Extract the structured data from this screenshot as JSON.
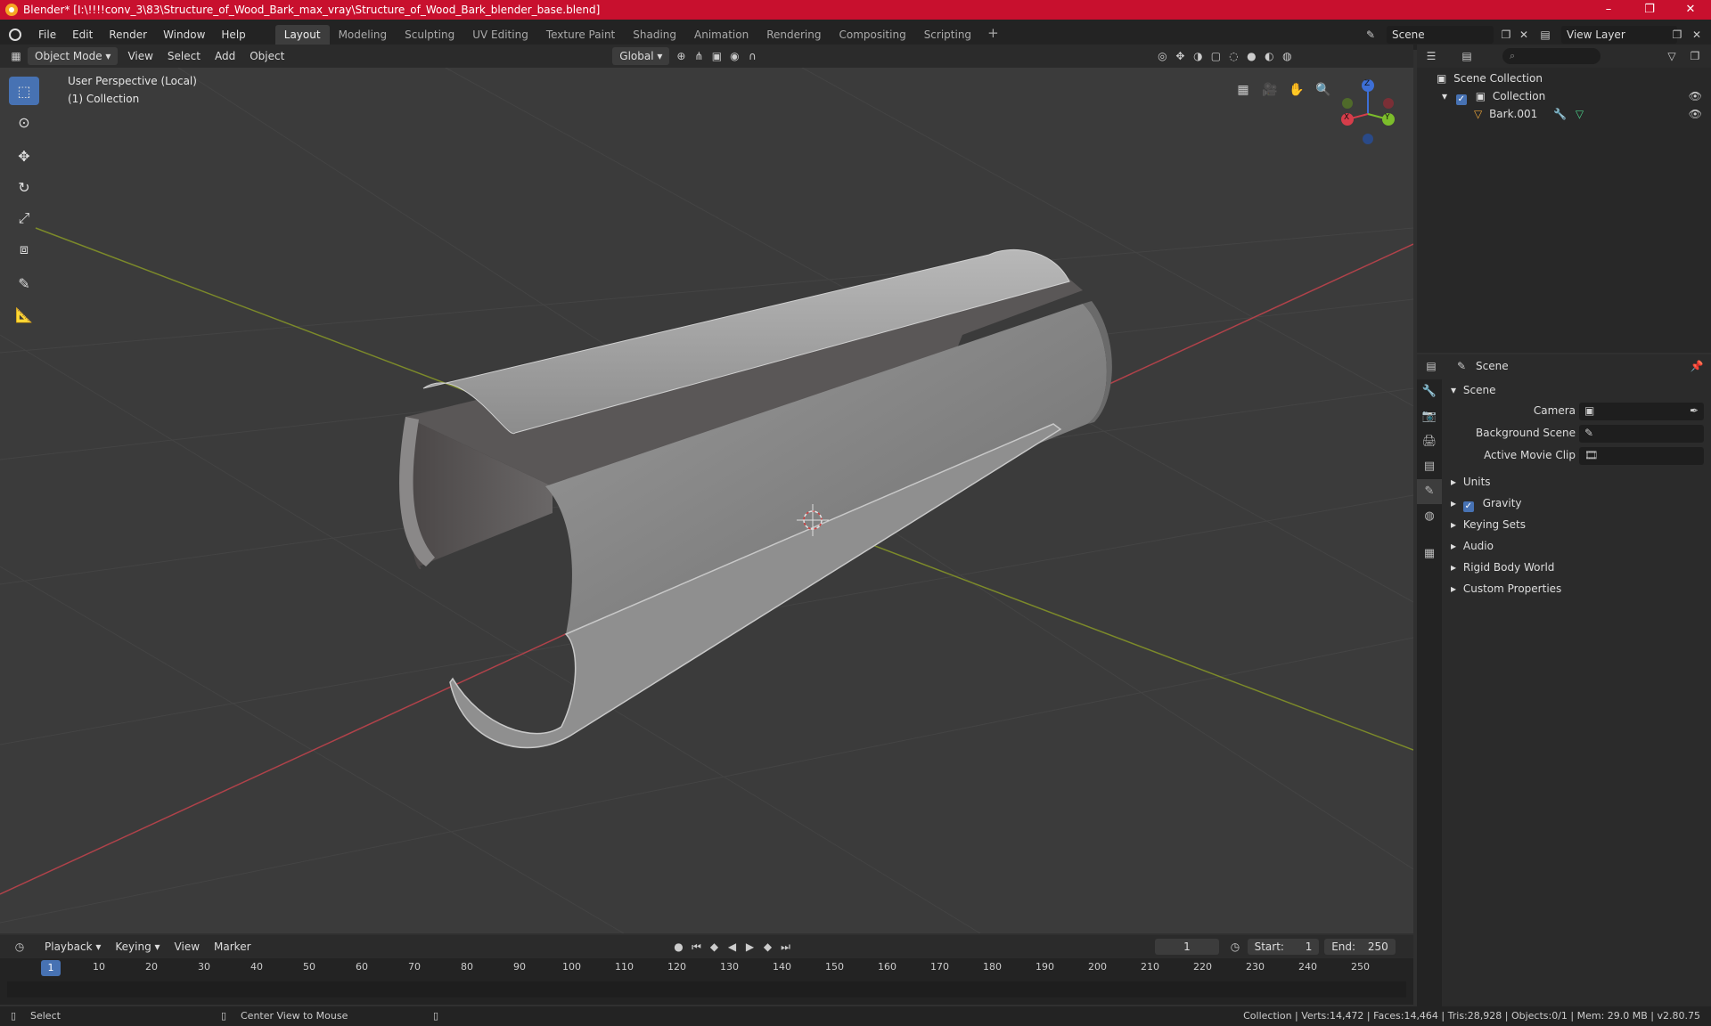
{
  "window": {
    "title": "Blender* [I:\\!!!!conv_3\\83\\Structure_of_Wood_Bark_max_vray\\Structure_of_Wood_Bark_blender_base.blend]",
    "minimize": "–",
    "maximize": "❐",
    "close": "✕"
  },
  "menu": [
    "File",
    "Edit",
    "Render",
    "Window",
    "Help"
  ],
  "workspaces": [
    "Layout",
    "Modeling",
    "Sculpting",
    "UV Editing",
    "Texture Paint",
    "Shading",
    "Animation",
    "Rendering",
    "Compositing",
    "Scripting"
  ],
  "workspace_add": "+",
  "scene": {
    "name": "Scene",
    "view_layer": "View Layer"
  },
  "viewport_header": {
    "mode": "Object Mode",
    "menus": [
      "View",
      "Select",
      "Add",
      "Object"
    ],
    "transform": "Global"
  },
  "viewport": {
    "perspective": "User Perspective (Local)",
    "collection": "(1) Collection",
    "gizmo": {
      "z": "Z",
      "x": "X",
      "y": "Y"
    }
  },
  "outliner": {
    "search_placeholder": "",
    "root": "Scene Collection",
    "collection": "Collection",
    "object": "Bark.001"
  },
  "properties": {
    "tab_title": "Scene",
    "panel": "Scene",
    "fields": [
      {
        "label": "Camera"
      },
      {
        "label": "Background Scene"
      },
      {
        "label": "Active Movie Clip"
      }
    ],
    "subpanels": [
      "Units",
      "Gravity",
      "Keying Sets",
      "Audio",
      "Rigid Body World",
      "Custom Properties"
    ]
  },
  "timeline": {
    "menus": [
      "Playback",
      "Keying",
      "View",
      "Marker"
    ],
    "current_frame": "1",
    "start_label": "Start:",
    "start": "1",
    "end_label": "End:",
    "end": "250",
    "ticks": [
      "1",
      "10",
      "20",
      "30",
      "40",
      "50",
      "60",
      "70",
      "80",
      "90",
      "100",
      "110",
      "120",
      "130",
      "140",
      "150",
      "160",
      "170",
      "180",
      "190",
      "200",
      "210",
      "220",
      "230",
      "240",
      "250"
    ]
  },
  "status": {
    "left": "Select",
    "middle": "Center View to Mouse",
    "right": "Collection | Verts:14,472 | Faces:14,464 | Tris:28,928 | Objects:0/1 | Mem: 29.0 MB | v2.80.75"
  }
}
